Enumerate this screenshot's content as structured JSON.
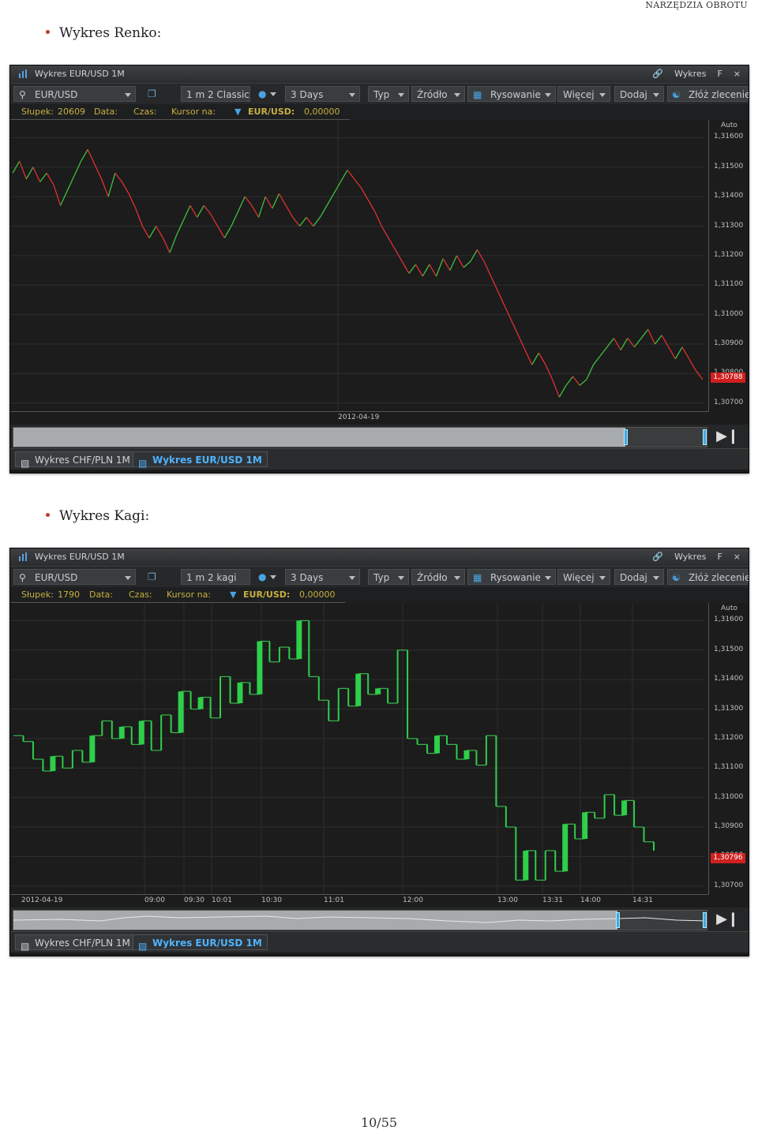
{
  "header": "NARZĘDZIA OBROTU",
  "footer": "10/55",
  "sections": [
    {
      "bullet": "Wykres Renko:",
      "window": {
        "title": "Wykres EUR/USD 1M",
        "title_right": "Wykres",
        "float_label": "F",
        "close_label": "×",
        "symbol": "EUR/USD",
        "chart_type": "1 m 2 Classic",
        "period": "3 Days",
        "buttons": {
          "typ": "Typ",
          "zrodlo": "Źródło",
          "rysowanie": "Rysowanie",
          "wiecej": "Więcej",
          "dodaj": "Dodaj",
          "zlecenie": "Złóż zlecenie"
        },
        "info": {
          "slupek_label": "Słupek:",
          "slupek_value": "20609",
          "data_label": "Data:",
          "czas_label": "Czas:",
          "kursor_label": "Kursor na:",
          "pair_label": "EUR/USD:",
          "pair_value": "0,00000"
        },
        "axis_auto": "Auto",
        "price_labels": [
          "1,31600",
          "1,31500",
          "1,31400",
          "1,31300",
          "1,31200",
          "1,31100",
          "1,31000",
          "1,30900",
          "1,30800",
          "1,30700"
        ],
        "current_price": "1,30788",
        "time_labels": [
          "2012-04-19"
        ],
        "tabs": [
          "Wykres CHF/PLN 1M",
          "Wykres EUR/USD 1M"
        ]
      }
    },
    {
      "bullet": "Wykres Kagi:",
      "window": {
        "title": "Wykres EUR/USD 1M",
        "title_right": "Wykres",
        "float_label": "F",
        "close_label": "×",
        "symbol": "EUR/USD",
        "chart_type": "1 m 2 kagi",
        "period": "3 Days",
        "buttons": {
          "typ": "Typ",
          "zrodlo": "Źródło",
          "rysowanie": "Rysowanie",
          "wiecej": "Więcej",
          "dodaj": "Dodaj",
          "zlecenie": "Złóż zlecenie"
        },
        "info": {
          "slupek_label": "Słupek:",
          "slupek_value": "1790",
          "data_label": "Data:",
          "czas_label": "Czas:",
          "kursor_label": "Kursor na:",
          "pair_label": "EUR/USD:",
          "pair_value": "0,00000"
        },
        "axis_auto": "Auto",
        "price_labels": [
          "1,31600",
          "1,31500",
          "1,31400",
          "1,31300",
          "1,31200",
          "1,31100",
          "1,31000",
          "1,30900",
          "1,30800",
          "1,30700"
        ],
        "current_price": "1,30796",
        "time_labels": [
          "2012-04-19",
          "09:00",
          "09:30",
          "10:01",
          "10:30",
          "11:01",
          "12:00",
          "13:00",
          "13:31",
          "14:00",
          "14:31"
        ],
        "tabs": [
          "Wykres CHF/PLN 1M",
          "Wykres EUR/USD 1M"
        ]
      }
    }
  ],
  "chart_data": [
    {
      "type": "line",
      "subtype": "renko",
      "y_range": [
        1.3067,
        1.3166
      ],
      "colors": {
        "up": "#3fbf3f",
        "down": "#e03030",
        "background": "#1c1c1c"
      },
      "series": [
        {
          "values": [
            1.3148,
            1.3152,
            1.3146,
            1.315,
            1.3145,
            1.3148,
            1.3144,
            1.3137,
            1.3142,
            1.3147,
            1.3152,
            1.3156,
            1.3151,
            1.3146,
            1.314,
            1.3148,
            1.3145,
            1.3141,
            1.3136,
            1.313,
            1.3126,
            1.313,
            1.3126,
            1.3121,
            1.3127,
            1.3132,
            1.3137,
            1.3133,
            1.3137,
            1.3134,
            1.313,
            1.3126,
            1.313,
            1.3135,
            1.314,
            1.3137,
            1.3133,
            1.314,
            1.3136,
            1.3141,
            1.3137,
            1.3133,
            1.313,
            1.3133,
            1.313,
            1.3133,
            1.3137,
            1.3141,
            1.3145,
            1.3149,
            1.3146,
            1.3143,
            1.3139,
            1.3135,
            1.313,
            1.3126,
            1.3122,
            1.3118,
            1.3114,
            1.3117,
            1.3113,
            1.3117,
            1.3113,
            1.3119,
            1.3115,
            1.312,
            1.3116,
            1.3118,
            1.3122,
            1.3118,
            1.3113,
            1.3108,
            1.3103,
            1.3098,
            1.3093,
            1.3088,
            1.3083,
            1.3087,
            1.3083,
            1.3078,
            1.3072,
            1.3076,
            1.3079,
            1.3076,
            1.3078,
            1.3083,
            1.3086,
            1.3089,
            1.3092,
            1.3088,
            1.3092,
            1.3089,
            1.3092,
            1.3095,
            1.309,
            1.3093,
            1.3089,
            1.3085,
            1.3089,
            1.3085,
            1.3081,
            1.3078
          ]
        }
      ]
    },
    {
      "type": "line",
      "subtype": "kagi",
      "y_range": [
        1.3067,
        1.3166
      ],
      "colors": {
        "yang": "#2ecf4a",
        "yin": "#35b84a",
        "background": "#1c1c1c"
      },
      "series": [
        {
          "values": [
            1.3121,
            1.3119,
            1.3113,
            1.3109,
            1.3114,
            1.311,
            1.3116,
            1.3112,
            1.3121,
            1.3126,
            1.312,
            1.3124,
            1.3118,
            1.3126,
            1.3116,
            1.3128,
            1.3122,
            1.3136,
            1.313,
            1.3134,
            1.3127,
            1.3141,
            1.3132,
            1.3139,
            1.3135,
            1.3153,
            1.3146,
            1.3151,
            1.3147,
            1.316,
            1.3141,
            1.3133,
            1.3126,
            1.3137,
            1.3131,
            1.3142,
            1.3135,
            1.3137,
            1.3132,
            1.315,
            1.312,
            1.3118,
            1.3115,
            1.3121,
            1.3118,
            1.3113,
            1.3116,
            1.3111,
            1.3121,
            1.3097,
            1.309,
            1.3072,
            1.3082,
            1.3072,
            1.3082,
            1.3075,
            1.3091,
            1.3086,
            1.3095,
            1.3093,
            1.3101,
            1.3094,
            1.3099,
            1.309,
            1.3085,
            1.3082
          ]
        }
      ]
    }
  ]
}
